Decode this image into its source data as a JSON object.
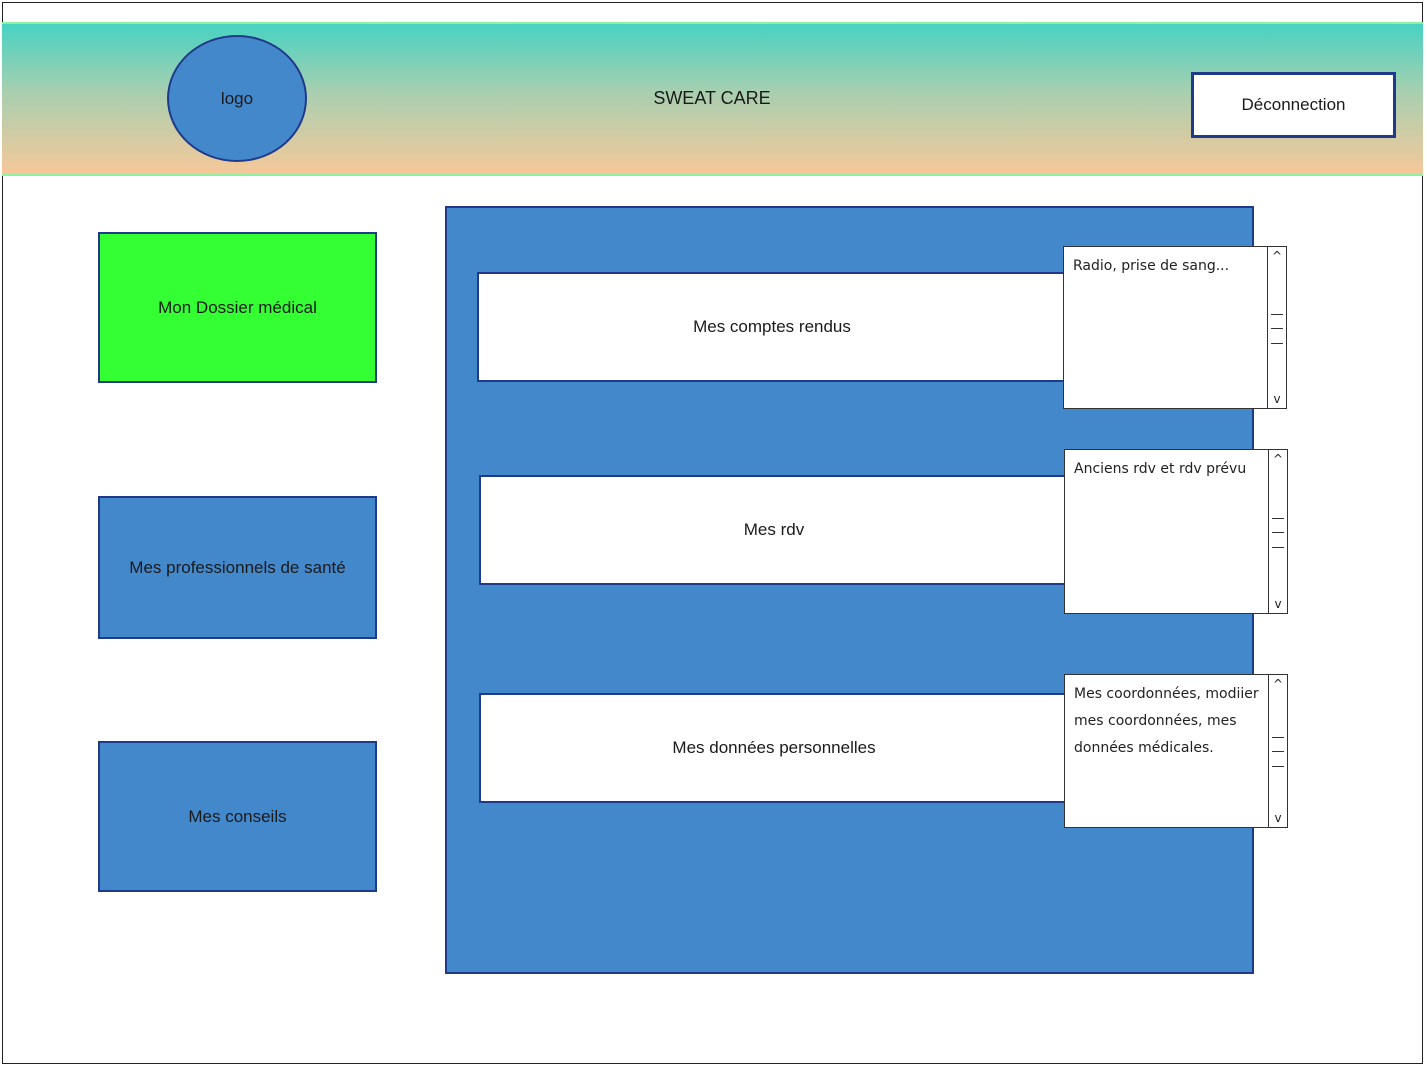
{
  "header": {
    "logo_label": "logo",
    "app_title": "SWEAT CARE",
    "logout_label": "Déconnection"
  },
  "nav": {
    "items": [
      {
        "label": "Mon Dossier médical",
        "active": true
      },
      {
        "label": "Mes professionnels de santé",
        "active": false
      },
      {
        "label": "Mes conseils",
        "active": false
      }
    ]
  },
  "main": {
    "sections": [
      {
        "label": "Mes comptes rendus",
        "note": "Radio, prise de sang..."
      },
      {
        "label": "Mes rdv",
        "note": "Anciens rdv et rdv prévu"
      },
      {
        "label": "Mes données personnelles",
        "note": "Mes coordonnées, modiier mes coordonnées, mes données médicales."
      }
    ]
  },
  "colors": {
    "primary": "#4488cc",
    "active": "#33ff33",
    "border": "#1f3a8a",
    "header_top": "#47d2c2",
    "header_bottom": "#f6c89a"
  }
}
